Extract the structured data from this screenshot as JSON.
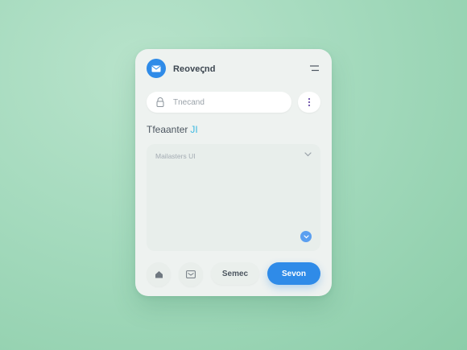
{
  "app": {
    "title": "Reoveꞔnd",
    "icon": "mail-icon",
    "menu_icon": "hamburger-icon"
  },
  "search": {
    "placeholder": "Tnecand",
    "icon": "lock-icon",
    "more_icon": "more-vertical-icon"
  },
  "section": {
    "title": "Tfeaanter",
    "accent": "JI"
  },
  "panel": {
    "header": "Mailasters UI",
    "chevron_icon": "chevron-down-icon",
    "fab_icon": "chevron-down-icon"
  },
  "bottom_bar": {
    "home_icon": "home-icon",
    "inbox_icon": "inbox-icon",
    "secondary_label": "Semec",
    "primary_label": "Sevon"
  },
  "colors": {
    "accent": "#2f8be8",
    "accent_text": "#3bb8e0",
    "background": "#a4dabd",
    "card": "#eef2f0"
  }
}
